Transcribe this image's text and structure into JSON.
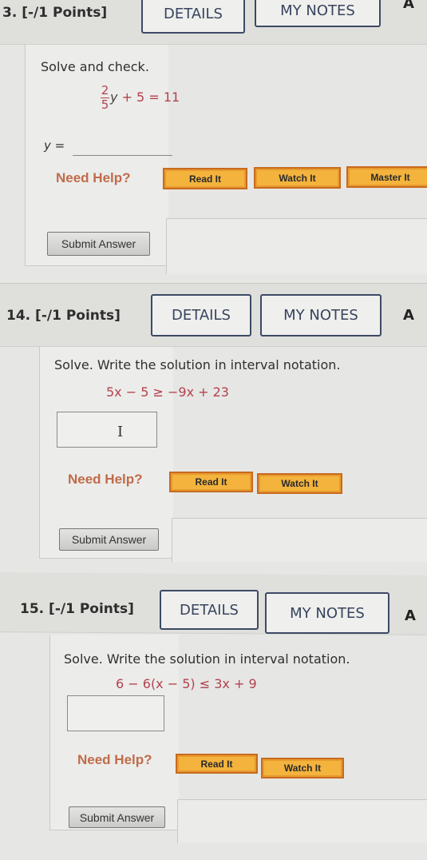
{
  "questions": [
    {
      "number_label": "3.",
      "points_label": "[-/1 Points]",
      "details_label": "DETAILS",
      "notes_label": "MY NOTES",
      "extra_label": "A",
      "prompt": "Solve and check.",
      "equation": {
        "frac_num": "2",
        "frac_den": "5",
        "var": "y",
        "rest": "+ 5 = 11"
      },
      "answer_label": "y =",
      "answer_value": "",
      "need_help": "Need Help?",
      "help_buttons": [
        "Read It",
        "Watch It",
        "Master It"
      ],
      "submit_label": "Submit Answer"
    },
    {
      "number_label": "14.",
      "points_label": "[-/1 Points]",
      "details_label": "DETAILS",
      "notes_label": "MY NOTES",
      "extra_label": "A",
      "prompt": "Solve. Write the solution in interval notation.",
      "equation_text": "5x − 5 ≥ −9x + 23",
      "answer_value": "",
      "need_help": "Need Help?",
      "help_buttons": [
        "Read It",
        "Watch It"
      ],
      "submit_label": "Submit Answer"
    },
    {
      "number_label": "15.",
      "points_label": "[-/1 Points]",
      "details_label": "DETAILS",
      "notes_label": "MY NOTES",
      "extra_label": "A",
      "prompt": "Solve. Write the solution in interval notation.",
      "equation_text": "6 − 6(x − 5) ≤ 3x + 9",
      "answer_value": "",
      "need_help": "Need Help?",
      "help_buttons": [
        "Read It",
        "Watch It"
      ],
      "submit_label": "Submit Answer"
    }
  ],
  "colors": {
    "need_help": "#c06b4a",
    "help_button_fill": "#f3b33d",
    "help_button_border": "#c86a1e",
    "math_red": "#b3424e",
    "header_button_border": "#3d4a66"
  }
}
